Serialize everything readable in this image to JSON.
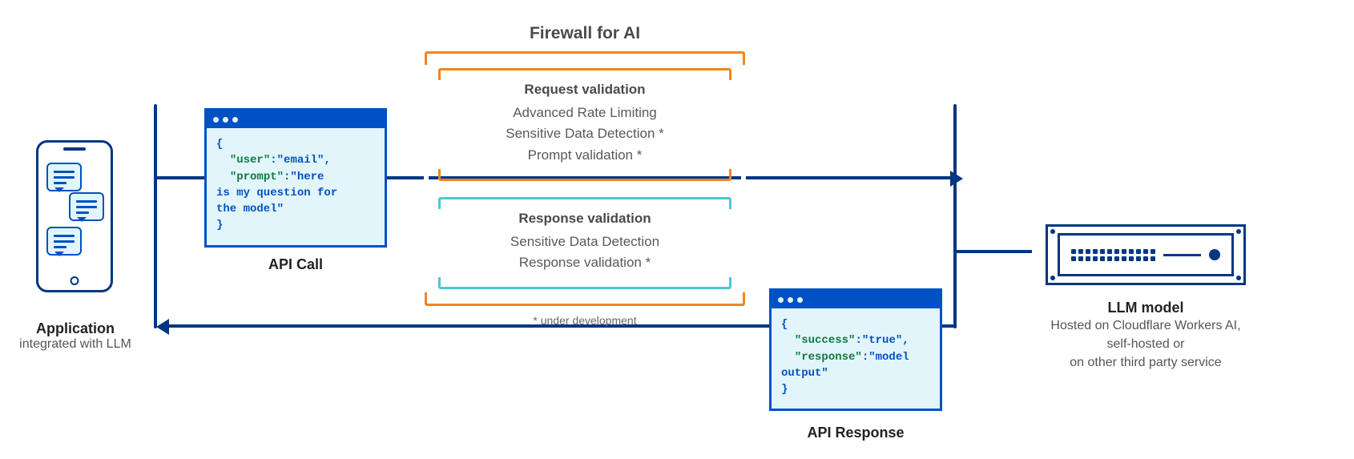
{
  "meta": {
    "title": "Firewall for AI architecture diagram"
  },
  "application": {
    "title": "Application",
    "subtitle": "integrated with LLM"
  },
  "api_call": {
    "label": "API Call",
    "body_line1": "{",
    "body_line2": "  \"user\":\"email\",",
    "body_line3": "  \"prompt\":\"here",
    "body_line4": "is my question for",
    "body_line5": "the model\"",
    "body_line6": "}"
  },
  "firewall": {
    "title": "Firewall for AI",
    "request": {
      "title": "Request validation",
      "line1": "Advanced Rate Limiting",
      "line2": "Sensitive Data Detection *",
      "line3": "Prompt validation *"
    },
    "response": {
      "title": "Response validation",
      "line1": "Sensitive Data Detection",
      "line2": "Response validation *"
    },
    "footnote": "* under development"
  },
  "api_response": {
    "label": "API Response",
    "body_line1": "{",
    "body_line2": "  \"success\":\"true\",",
    "body_line3": "  \"response\":\"model",
    "body_line4": "output\"",
    "body_line5": "}"
  },
  "llm": {
    "title": "LLM model",
    "sub_line1": "Hosted on Cloudflare Workers AI,",
    "sub_line2": "self-hosted or",
    "sub_line3": "on other third party service"
  },
  "colors": {
    "primary_blue": "#003682",
    "accent_blue": "#0051c3",
    "panel_blue": "#e2f5fb",
    "orange": "#f6821f",
    "teal": "#4cc8d6",
    "code_green": "#0f7a3e"
  }
}
